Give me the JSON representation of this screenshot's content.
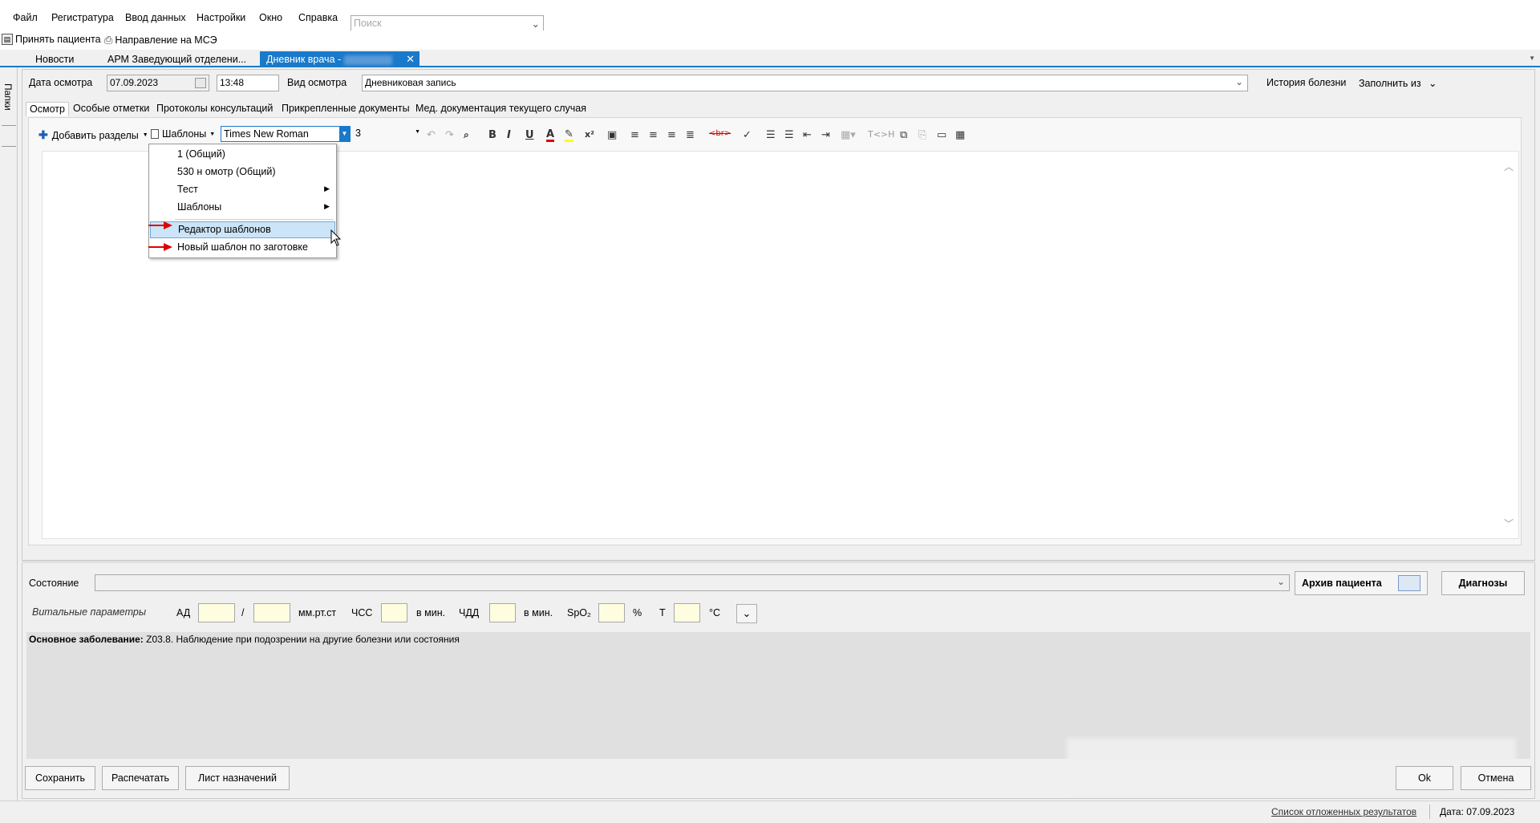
{
  "menubar": {
    "items": [
      "Файл",
      "Регистратура",
      "Ввод данных",
      "Настройки",
      "Окно",
      "Справка"
    ],
    "search_placeholder": "Поиск"
  },
  "toolbar": {
    "accept_patient": "Принять пациента",
    "mse_referral": "Направление на МСЭ"
  },
  "doc_tabs": [
    "Новости",
    "АРМ Заведующий отделени...",
    "Дневник врача - "
  ],
  "left_strip_label": "Папки",
  "exam": {
    "date_label": "Дата осмотра",
    "date_value": "07.09.2023",
    "time_value": "13:48",
    "type_label": "Вид осмотра",
    "type_value": "Дневниковая  запись",
    "history_label": "История болезни",
    "fill_from_label": "Заполнить из"
  },
  "subtabs": [
    "Осмотр",
    "Особые отметки",
    "Протоколы консультаций",
    "Прикрепленные документы",
    "Мед. документация текущего случая"
  ],
  "editor_toolbar": {
    "add_sections": "Добавить разделы",
    "templates": "Шаблоны",
    "font_name": "Times New Roman",
    "font_size": "3",
    "tag_label": "T<>H"
  },
  "templates_menu": {
    "items": [
      "1 (Общий)",
      "530 н омотр (Общий)",
      "Тест",
      "Шаблоны",
      "Редактор шаблонов",
      "Новый шаблон по заготовке"
    ]
  },
  "state": {
    "label": "Состояние",
    "archive_button": "Архив пациента",
    "diagnoses_button": "Диагнозы"
  },
  "vitals": {
    "title": "Витальные параметры",
    "ad_label": "АД",
    "slash": "/",
    "ad_unit": "мм.рт.ст",
    "hr_label": "ЧСС",
    "hr_unit": "в мин.",
    "rr_label": "ЧДД",
    "rr_unit": "в мин.",
    "spo2_label": "SpO₂",
    "spo2_unit": "%",
    "t_label": "Т",
    "t_unit": "°С"
  },
  "diagnosis": {
    "label": "Основное заболевание:",
    "text": "Z03.8. Наблюдение при подозрении на другие болезни или состояния"
  },
  "buttons": {
    "save": "Сохранить",
    "print": "Распечатать",
    "prescriptions": "Лист назначений",
    "ok": "Ok",
    "cancel": "Отмена"
  },
  "statusbar": {
    "deferred_results": "Список отложенных результатов",
    "date": "Дата: 07.09.2023"
  },
  "colors": {
    "accent": "#1979ca",
    "input_yellow": "#fffde0",
    "menu_highlight": "#cce4f7",
    "arrow_red": "#e00000"
  }
}
